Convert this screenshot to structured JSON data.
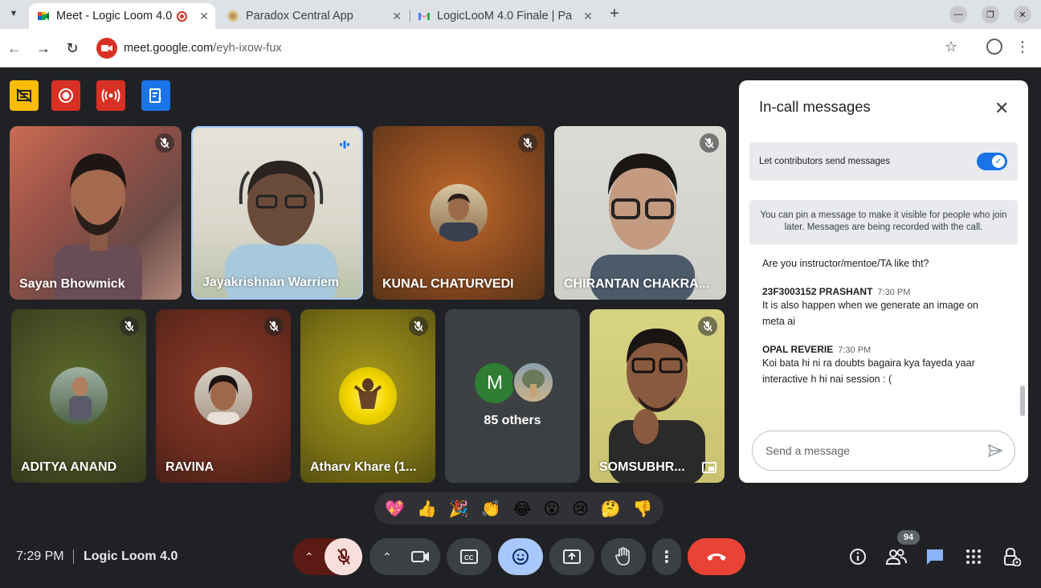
{
  "browser": {
    "tabs": [
      {
        "title": "Meet - Logic Loom 4.0",
        "active": true
      },
      {
        "title": "Paradox Central App",
        "active": false
      },
      {
        "title": "LogicLooM 4.0 Finale | Pa",
        "active": false
      }
    ],
    "url_host": "meet.google.com",
    "url_path": "/eyh-ixow-fux"
  },
  "participants": [
    {
      "name": "Sayan Bhowmick",
      "muted": true
    },
    {
      "name": "Jayakrishnan Warriem",
      "speaking": true
    },
    {
      "name": "KUNAL CHATURVEDI",
      "muted": true
    },
    {
      "name": "CHIRANTAN CHAKRA...",
      "muted": true
    },
    {
      "name": "ADITYA ANAND",
      "muted": true
    },
    {
      "name": "RAVINA",
      "muted": true
    },
    {
      "name": "Atharv Khare (1...",
      "muted": true
    },
    {
      "name": "SOMSUBHR...",
      "muted": true
    }
  ],
  "others": {
    "initial": "M",
    "label": "85 others"
  },
  "chat": {
    "title": "In-call messages",
    "toggle_label": "Let contributors send messages",
    "toggle_on": true,
    "pin_info": "You can pin a message to make it visible for people who join later. Messages are being recorded with the call.",
    "messages": [
      {
        "sender": "",
        "time": "",
        "text": "Are you instructor/mentoe/TA like tht?"
      },
      {
        "sender": "23F3003152 PRASHANT",
        "time": "7:30 PM",
        "text": "It is also happen when we generate an image on meta ai"
      },
      {
        "sender": "OPAL REVERIE",
        "time": "7:30 PM",
        "text": "Koi bata hi ni ra doubts bagaira kya fayeda yaar interactive h hi nai session : ("
      }
    ],
    "input_placeholder": "Send a message"
  },
  "reactions": [
    "💖",
    "👍",
    "🎉",
    "👏",
    "😂",
    "😮",
    "😢",
    "🤔",
    "👎"
  ],
  "bottom": {
    "time": "7:29 PM",
    "meeting_name": "Logic Loom 4.0",
    "people_count": "94"
  },
  "colors": {
    "meet_bg": "#202124",
    "end_call": "#ea4335",
    "mic_off": "#f9dedc",
    "accent": "#1a73e8",
    "emoji_active": "#a8c7fa"
  }
}
